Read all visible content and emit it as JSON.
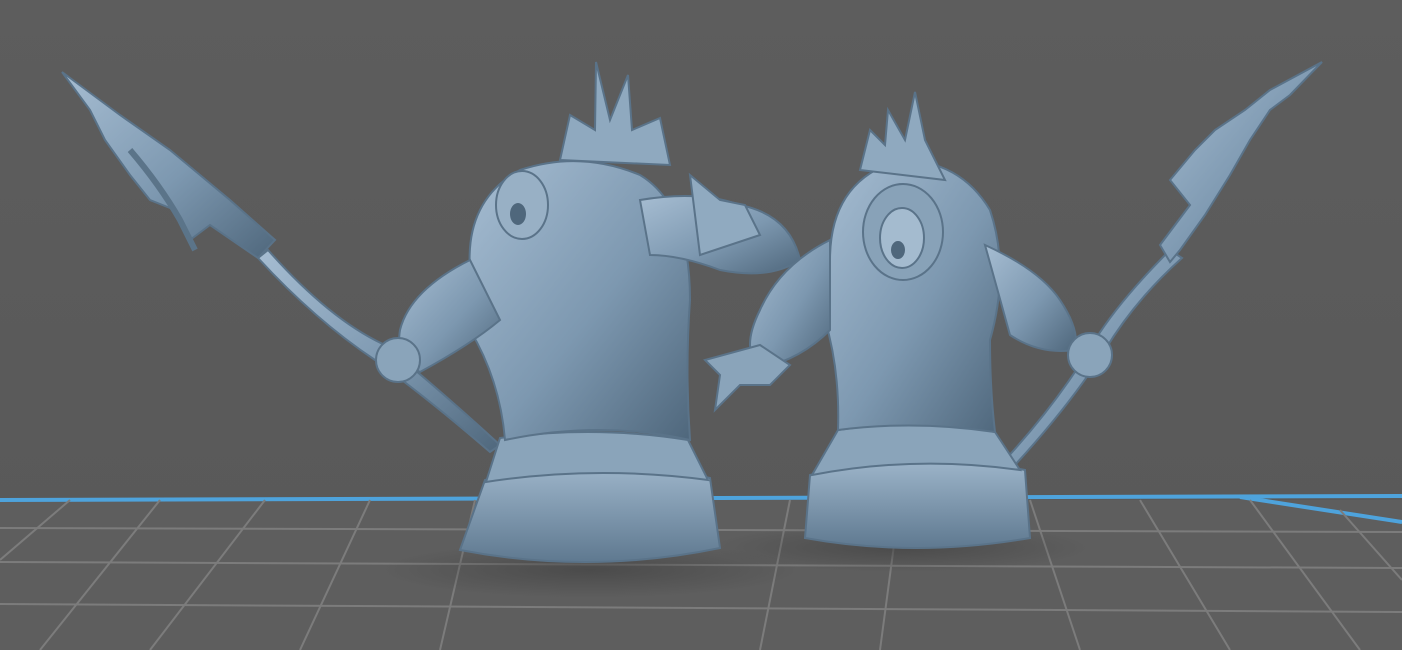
{
  "viewport": {
    "background_color": "#5b5b5b",
    "grid_line_color": "#7d7d7d",
    "plate_edge_color": "#4ea3dc",
    "model_color": "#7d98b0",
    "model_highlight_color": "#a9c0d4",
    "model_shadow_color": "#4d6478"
  },
  "scene": {
    "models": [
      {
        "id": "left-figure",
        "kind": "hooded figure bust holding spear"
      },
      {
        "id": "right-figure",
        "kind": "hooded figure bust holding spear"
      }
    ]
  }
}
